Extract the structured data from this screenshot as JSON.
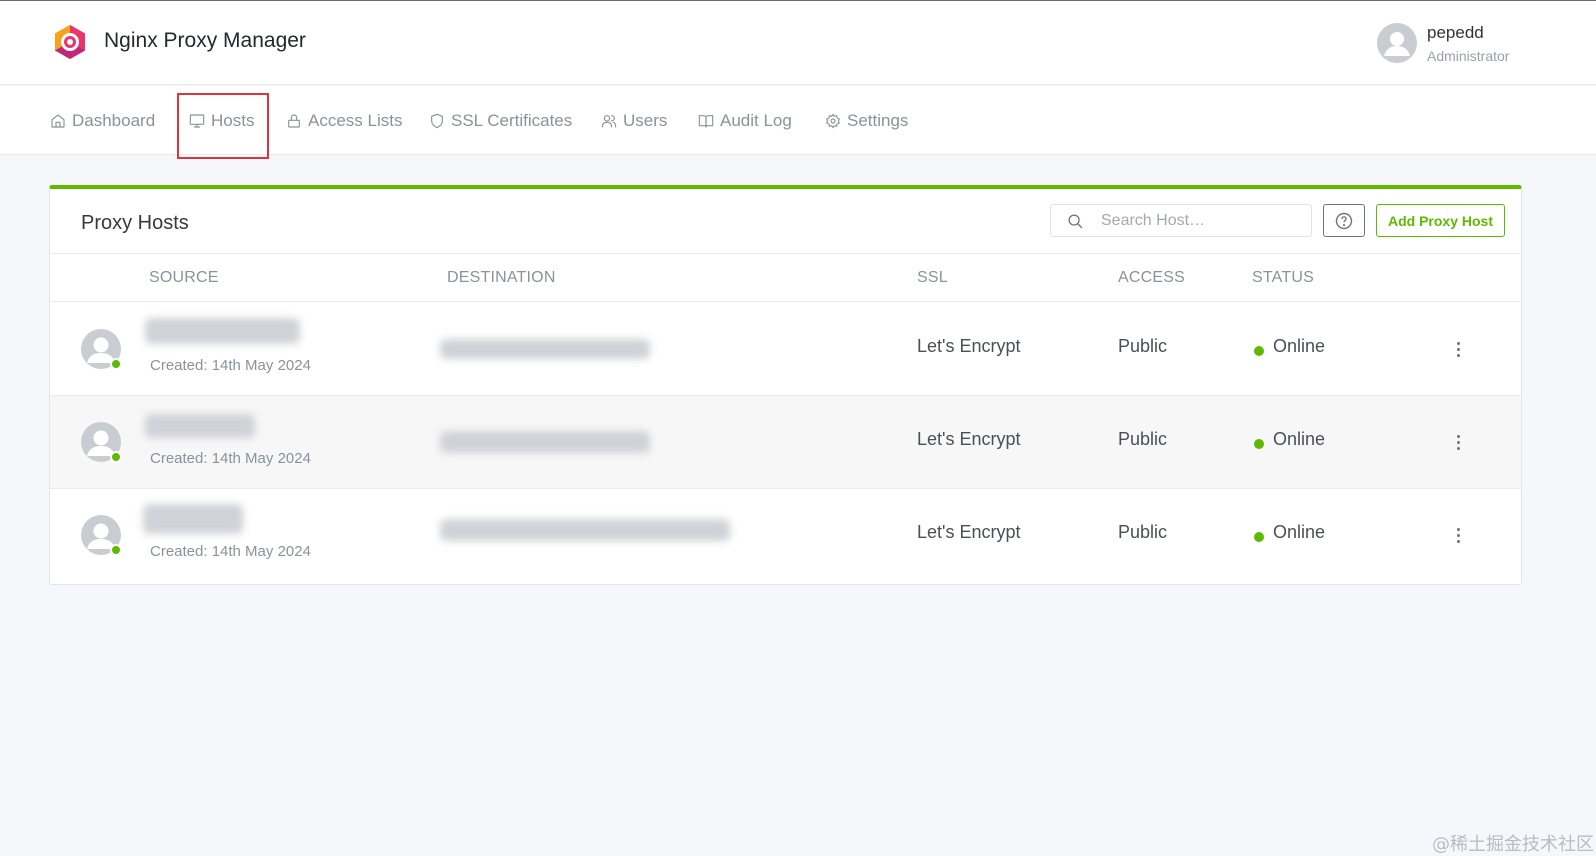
{
  "app": {
    "title": "Nginx Proxy Manager",
    "logo_icon": "nginx-proxy-manager-logo"
  },
  "user": {
    "name": "pepedd",
    "role": "Administrator",
    "avatar_icon": "user-avatar-icon"
  },
  "nav": {
    "items": [
      {
        "label": "Dashboard",
        "icon": "home-icon"
      },
      {
        "label": "Hosts",
        "icon": "monitor-icon",
        "highlighted": true
      },
      {
        "label": "Access Lists",
        "icon": "lock-icon"
      },
      {
        "label": "SSL Certificates",
        "icon": "shield-icon"
      },
      {
        "label": "Users",
        "icon": "users-icon"
      },
      {
        "label": "Audit Log",
        "icon": "book-icon"
      },
      {
        "label": "Settings",
        "icon": "settings-icon"
      }
    ]
  },
  "card": {
    "title": "Proxy Hosts",
    "search_placeholder": "Search Host…",
    "help_icon": "help-circle-icon",
    "add_button": "Add Proxy Host",
    "accent_color": "#5eba00"
  },
  "table": {
    "columns": [
      "SOURCE",
      "DESTINATION",
      "SSL",
      "ACCESS",
      "STATUS"
    ],
    "rows": [
      {
        "created": "Created: 14th May 2024",
        "ssl": "Let's Encrypt",
        "access": "Public",
        "status": "Online"
      },
      {
        "created": "Created: 14th May 2024",
        "ssl": "Let's Encrypt",
        "access": "Public",
        "status": "Online"
      },
      {
        "created": "Created: 14th May 2024",
        "ssl": "Let's Encrypt",
        "access": "Public",
        "status": "Online"
      }
    ]
  },
  "watermark": "@稀土掘金技术社区"
}
